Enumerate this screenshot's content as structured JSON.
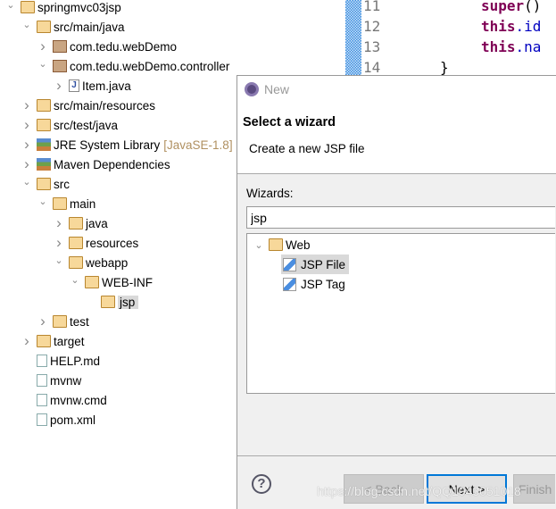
{
  "explorer": {
    "items": [
      {
        "label": "springmvc03jsp",
        "level": 0,
        "state": "expanded",
        "icon": "maven-project-icon"
      },
      {
        "label": "src/main/java",
        "level": 1,
        "state": "expanded",
        "icon": "source-folder-icon"
      },
      {
        "label": "com.tedu.webDemo",
        "level": 2,
        "state": "collapsed",
        "icon": "package-icon"
      },
      {
        "label": "com.tedu.webDemo.controller",
        "level": 2,
        "state": "expanded",
        "icon": "package-icon"
      },
      {
        "label": "Item.java",
        "level": 3,
        "state": "collapsed",
        "icon": "java-file-icon"
      },
      {
        "label": "src/main/resources",
        "level": 1,
        "state": "collapsed",
        "icon": "source-folder-icon"
      },
      {
        "label": "src/test/java",
        "level": 1,
        "state": "collapsed",
        "icon": "source-folder-icon"
      },
      {
        "label": "JRE System Library",
        "decoration": "[JavaSE-1.8]",
        "level": 1,
        "state": "collapsed",
        "icon": "library-icon"
      },
      {
        "label": "Maven Dependencies",
        "level": 1,
        "state": "collapsed",
        "icon": "library-icon"
      },
      {
        "label": "src",
        "level": 1,
        "state": "expanded",
        "icon": "folder-icon"
      },
      {
        "label": "main",
        "level": 2,
        "state": "expanded",
        "icon": "folder-icon"
      },
      {
        "label": "java",
        "level": 3,
        "state": "collapsed",
        "icon": "folder-icon"
      },
      {
        "label": "resources",
        "level": 3,
        "state": "collapsed",
        "icon": "folder-icon"
      },
      {
        "label": "webapp",
        "level": 3,
        "state": "expanded",
        "icon": "folder-icon"
      },
      {
        "label": "WEB-INF",
        "level": 4,
        "state": "expanded",
        "icon": "folder-icon"
      },
      {
        "label": "jsp",
        "level": 5,
        "state": "none",
        "icon": "folder-icon",
        "selected": true
      },
      {
        "label": "test",
        "level": 2,
        "state": "collapsed",
        "icon": "folder-icon"
      },
      {
        "label": "target",
        "level": 1,
        "state": "collapsed",
        "icon": "folder-icon"
      },
      {
        "label": "HELP.md",
        "level": 1,
        "state": "none",
        "icon": "markdown-file-icon"
      },
      {
        "label": "mvnw",
        "level": 1,
        "state": "none",
        "icon": "text-file-icon"
      },
      {
        "label": "mvnw.cmd",
        "level": 1,
        "state": "none",
        "icon": "cmd-file-icon"
      },
      {
        "label": "pom.xml",
        "level": 1,
        "state": "none",
        "icon": "pom-file-icon"
      }
    ]
  },
  "editor": {
    "lines": [
      {
        "num": "11",
        "kw": "super",
        "rest": "()"
      },
      {
        "num": "12",
        "kw": "this",
        "rest": ".id"
      },
      {
        "num": "13",
        "kw": "this",
        "rest": ".na"
      },
      {
        "num": "14",
        "kw": "",
        "rest": "}"
      }
    ]
  },
  "dialog": {
    "title": "New",
    "heading": "Select a wizard",
    "description": "Create a new JSP file",
    "wizards_label": "Wizards:",
    "filter_value": "jsp",
    "tree": {
      "category": "Web",
      "items": [
        "JSP File",
        "JSP Tag"
      ],
      "selected": "JSP File"
    },
    "buttons": {
      "back": "< Back",
      "next": "Next >",
      "finish": "Finish"
    },
    "help": "?"
  },
  "watermark": "https://blog.csdn.net/QQ1043051018"
}
